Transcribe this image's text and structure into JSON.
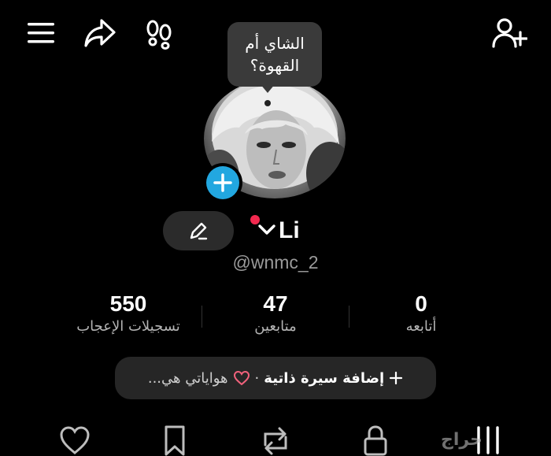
{
  "header": {
    "icons": [
      "menu-icon",
      "share-icon",
      "footprints-icon",
      "add-user-icon"
    ]
  },
  "profile": {
    "status_bubble": "الشاي أم\nالقهوة؟",
    "name": "Li",
    "username": "@wnmc_2"
  },
  "stats": [
    {
      "value": "550",
      "label": "تسجيلات الإعجاب"
    },
    {
      "value": "47",
      "label": "متابعين"
    },
    {
      "value": "0",
      "label": "أتابعه"
    }
  ],
  "bio": {
    "add_label": "إضافة سيرة ذاتية",
    "separator": "·",
    "hobbies_text": "هواياتي هي..."
  },
  "tabs": {
    "icons": [
      "heart-icon",
      "bookmark-icon",
      "repost-icon",
      "lock-icon",
      "grid-icon"
    ]
  },
  "watermark": "حراج",
  "colors": {
    "accent_blue": "#22a7e0",
    "notification_red": "#f2294f",
    "heart_pink": "#f2627c"
  }
}
